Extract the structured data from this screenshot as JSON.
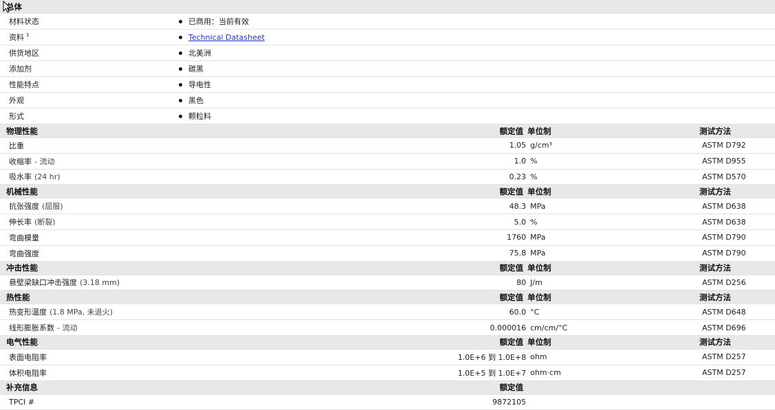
{
  "general": {
    "title": "总体",
    "rows": [
      {
        "label": "材料状态",
        "value": "已商用：当前有效"
      },
      {
        "label": "资料",
        "sup": "1",
        "value": "Technical Datasheet",
        "link": true
      },
      {
        "label": "供货地区",
        "value": "北美洲"
      },
      {
        "label": "添加剂",
        "value": "碳黑"
      },
      {
        "label": "性能特点",
        "value": "导电性"
      },
      {
        "label": "外观",
        "value": "黑色"
      },
      {
        "label": "形式",
        "value": "颗粒料"
      }
    ]
  },
  "header_labels": {
    "value": "额定值",
    "unit": "单位制",
    "method": "测试方法"
  },
  "sections": [
    {
      "title": "物理性能",
      "rows": [
        {
          "label": "比重",
          "cond": "",
          "value": "1.05",
          "unit": "g/cm³",
          "method": "ASTM D792"
        },
        {
          "label": "收缩率",
          "cond": "- 流动",
          "value": "1.0",
          "unit": "%",
          "method": "ASTM D955"
        },
        {
          "label": "吸水率",
          "cond": "(24 hr)",
          "value": "0.23",
          "unit": "%",
          "method": "ASTM D570"
        }
      ]
    },
    {
      "title": "机械性能",
      "rows": [
        {
          "label": "抗张强度",
          "cond": "(屈服)",
          "value": "48.3",
          "unit": "MPa",
          "method": "ASTM D638"
        },
        {
          "label": "伸长率",
          "cond": "(断裂)",
          "value": "5.0",
          "unit": "%",
          "method": "ASTM D638"
        },
        {
          "label": "弯曲模量",
          "cond": "",
          "value": "1760",
          "unit": "MPa",
          "method": "ASTM D790"
        },
        {
          "label": "弯曲强度",
          "cond": "",
          "value": "75.8",
          "unit": "MPa",
          "method": "ASTM D790"
        }
      ]
    },
    {
      "title": "冲击性能",
      "rows": [
        {
          "label": "悬壁梁缺口冲击强度",
          "cond": "(3.18 mm)",
          "value": "80",
          "unit": "J/m",
          "method": "ASTM D256"
        }
      ]
    },
    {
      "title": "热性能",
      "rows": [
        {
          "label": "热变形温度",
          "cond": "(1.8 MPa, 未退火)",
          "value": "60.0",
          "unit": "°C",
          "method": "ASTM D648"
        },
        {
          "label": "线形膨胀系数",
          "cond": "- 流动",
          "value": "0.000016",
          "unit": "cm/cm/°C",
          "method": "ASTM D696"
        }
      ]
    },
    {
      "title": "电气性能",
      "rows": [
        {
          "label": "表面电阻率",
          "cond": "",
          "value": "1.0E+6 到  1.0E+8",
          "unit": "ohm",
          "method": "ASTM D257"
        },
        {
          "label": "体积电阻率",
          "cond": "",
          "value": "1.0E+5 到  1.0E+7",
          "unit": "ohm·cm",
          "method": "ASTM D257"
        }
      ]
    },
    {
      "title": "补充信息",
      "value_only": true,
      "rows": [
        {
          "label": "TPCI #",
          "cond": "",
          "value": "9872105",
          "unit": "",
          "method": ""
        }
      ]
    }
  ]
}
